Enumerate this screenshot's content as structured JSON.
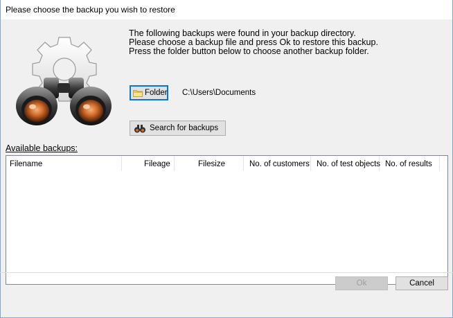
{
  "window": {
    "title": "Please choose the backup you wish to restore"
  },
  "intro": {
    "line1": "The following backups were found in your backup directory.",
    "line2": "Please choose a backup file and press Ok to restore this backup.",
    "line3": "Press the folder button below to choose another backup folder."
  },
  "folder": {
    "button_label": "Folder",
    "path": "C:\\Users\\Documents"
  },
  "search": {
    "button_label": "Search for backups"
  },
  "backups": {
    "label": "Available backups:",
    "columns": [
      "Filename",
      "Fileage",
      "Filesize",
      "No. of customers",
      "No. of test objects",
      "No. of results"
    ],
    "rows": []
  },
  "footer": {
    "ok_label": "Ok",
    "cancel_label": "Cancel"
  },
  "icons": {
    "illustration": "gear-binoculars-icon",
    "folder": "folder-icon",
    "search": "binoculars-icon"
  },
  "colors": {
    "focus_border": "#0078d7",
    "window_border": "#7aa7d8"
  }
}
